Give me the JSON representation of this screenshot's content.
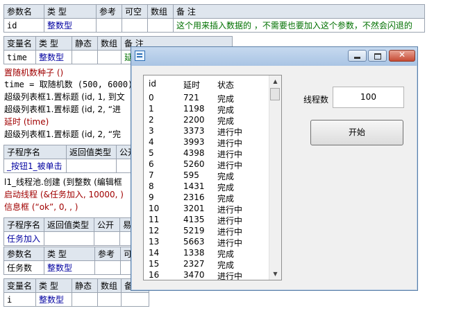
{
  "table1": {
    "headers": [
      "参数名",
      "类 型",
      "参考",
      "可空",
      "数组",
      "备 注"
    ],
    "row": [
      "id",
      "整数型",
      "",
      "",
      "",
      "这个用来插入数据的      ，不需要也要加入这个参数，不然会闪退的"
    ]
  },
  "table2": {
    "headers": [
      "变量名",
      "类 型",
      "静态",
      "数组",
      "备 注"
    ],
    "row": [
      "time",
      "整数型",
      "",
      "",
      "延"
    ]
  },
  "code1": [
    "置随机数种子 ()",
    "time = 取随机数 (500, 6000)",
    "超级列表框1.置标题 (id, 1, 到文",
    "超级列表框1.置标题 (id, 2, “进",
    "延时 (time)",
    "超级列表框1.置标题 (id, 2, “完"
  ],
  "table3": {
    "headers": [
      "子程序名",
      "返回值类型",
      "公开"
    ],
    "row": [
      "_按钮1_被单击",
      "",
      ""
    ]
  },
  "code2": [
    "l1_线程池.创建 (到整数 (编辑框",
    "启动线程 (&任务加入, 10000, )",
    "信息框 (“ok”, 0, , )"
  ],
  "table4": {
    "headers": [
      "子程序名",
      "返回值类型",
      "公开",
      "易"
    ],
    "row": [
      "任务加入",
      "",
      "",
      ""
    ]
  },
  "table5": {
    "headers": [
      "参数名",
      "类 型",
      "参考",
      "可空"
    ],
    "row": [
      "任务数",
      "整数型",
      "",
      ""
    ]
  },
  "table6": {
    "headers": [
      "变量名",
      "类 型",
      "静态",
      "数组",
      "备"
    ],
    "row": [
      "i",
      "整数型",
      "",
      "",
      ""
    ]
  },
  "dialog": {
    "list_headers": [
      "id",
      "延时",
      "状态"
    ],
    "rows": [
      [
        "0",
        "721",
        "完成"
      ],
      [
        "1",
        "1198",
        "完成"
      ],
      [
        "2",
        "2200",
        "完成"
      ],
      [
        "3",
        "3373",
        "进行中"
      ],
      [
        "4",
        "3993",
        "进行中"
      ],
      [
        "5",
        "4398",
        "进行中"
      ],
      [
        "6",
        "5260",
        "进行中"
      ],
      [
        "7",
        "595",
        "完成"
      ],
      [
        "8",
        "1431",
        "完成"
      ],
      [
        "9",
        "2316",
        "完成"
      ],
      [
        "10",
        "3201",
        "进行中"
      ],
      [
        "11",
        "4135",
        "进行中"
      ],
      [
        "12",
        "5219",
        "进行中"
      ],
      [
        "13",
        "5663",
        "进行中"
      ],
      [
        "14",
        "1338",
        "完成"
      ],
      [
        "15",
        "2327",
        "完成"
      ],
      [
        "16",
        "3470",
        "进行中"
      ]
    ],
    "thread_label": "线程数",
    "thread_value": "100",
    "start_label": "开始"
  }
}
